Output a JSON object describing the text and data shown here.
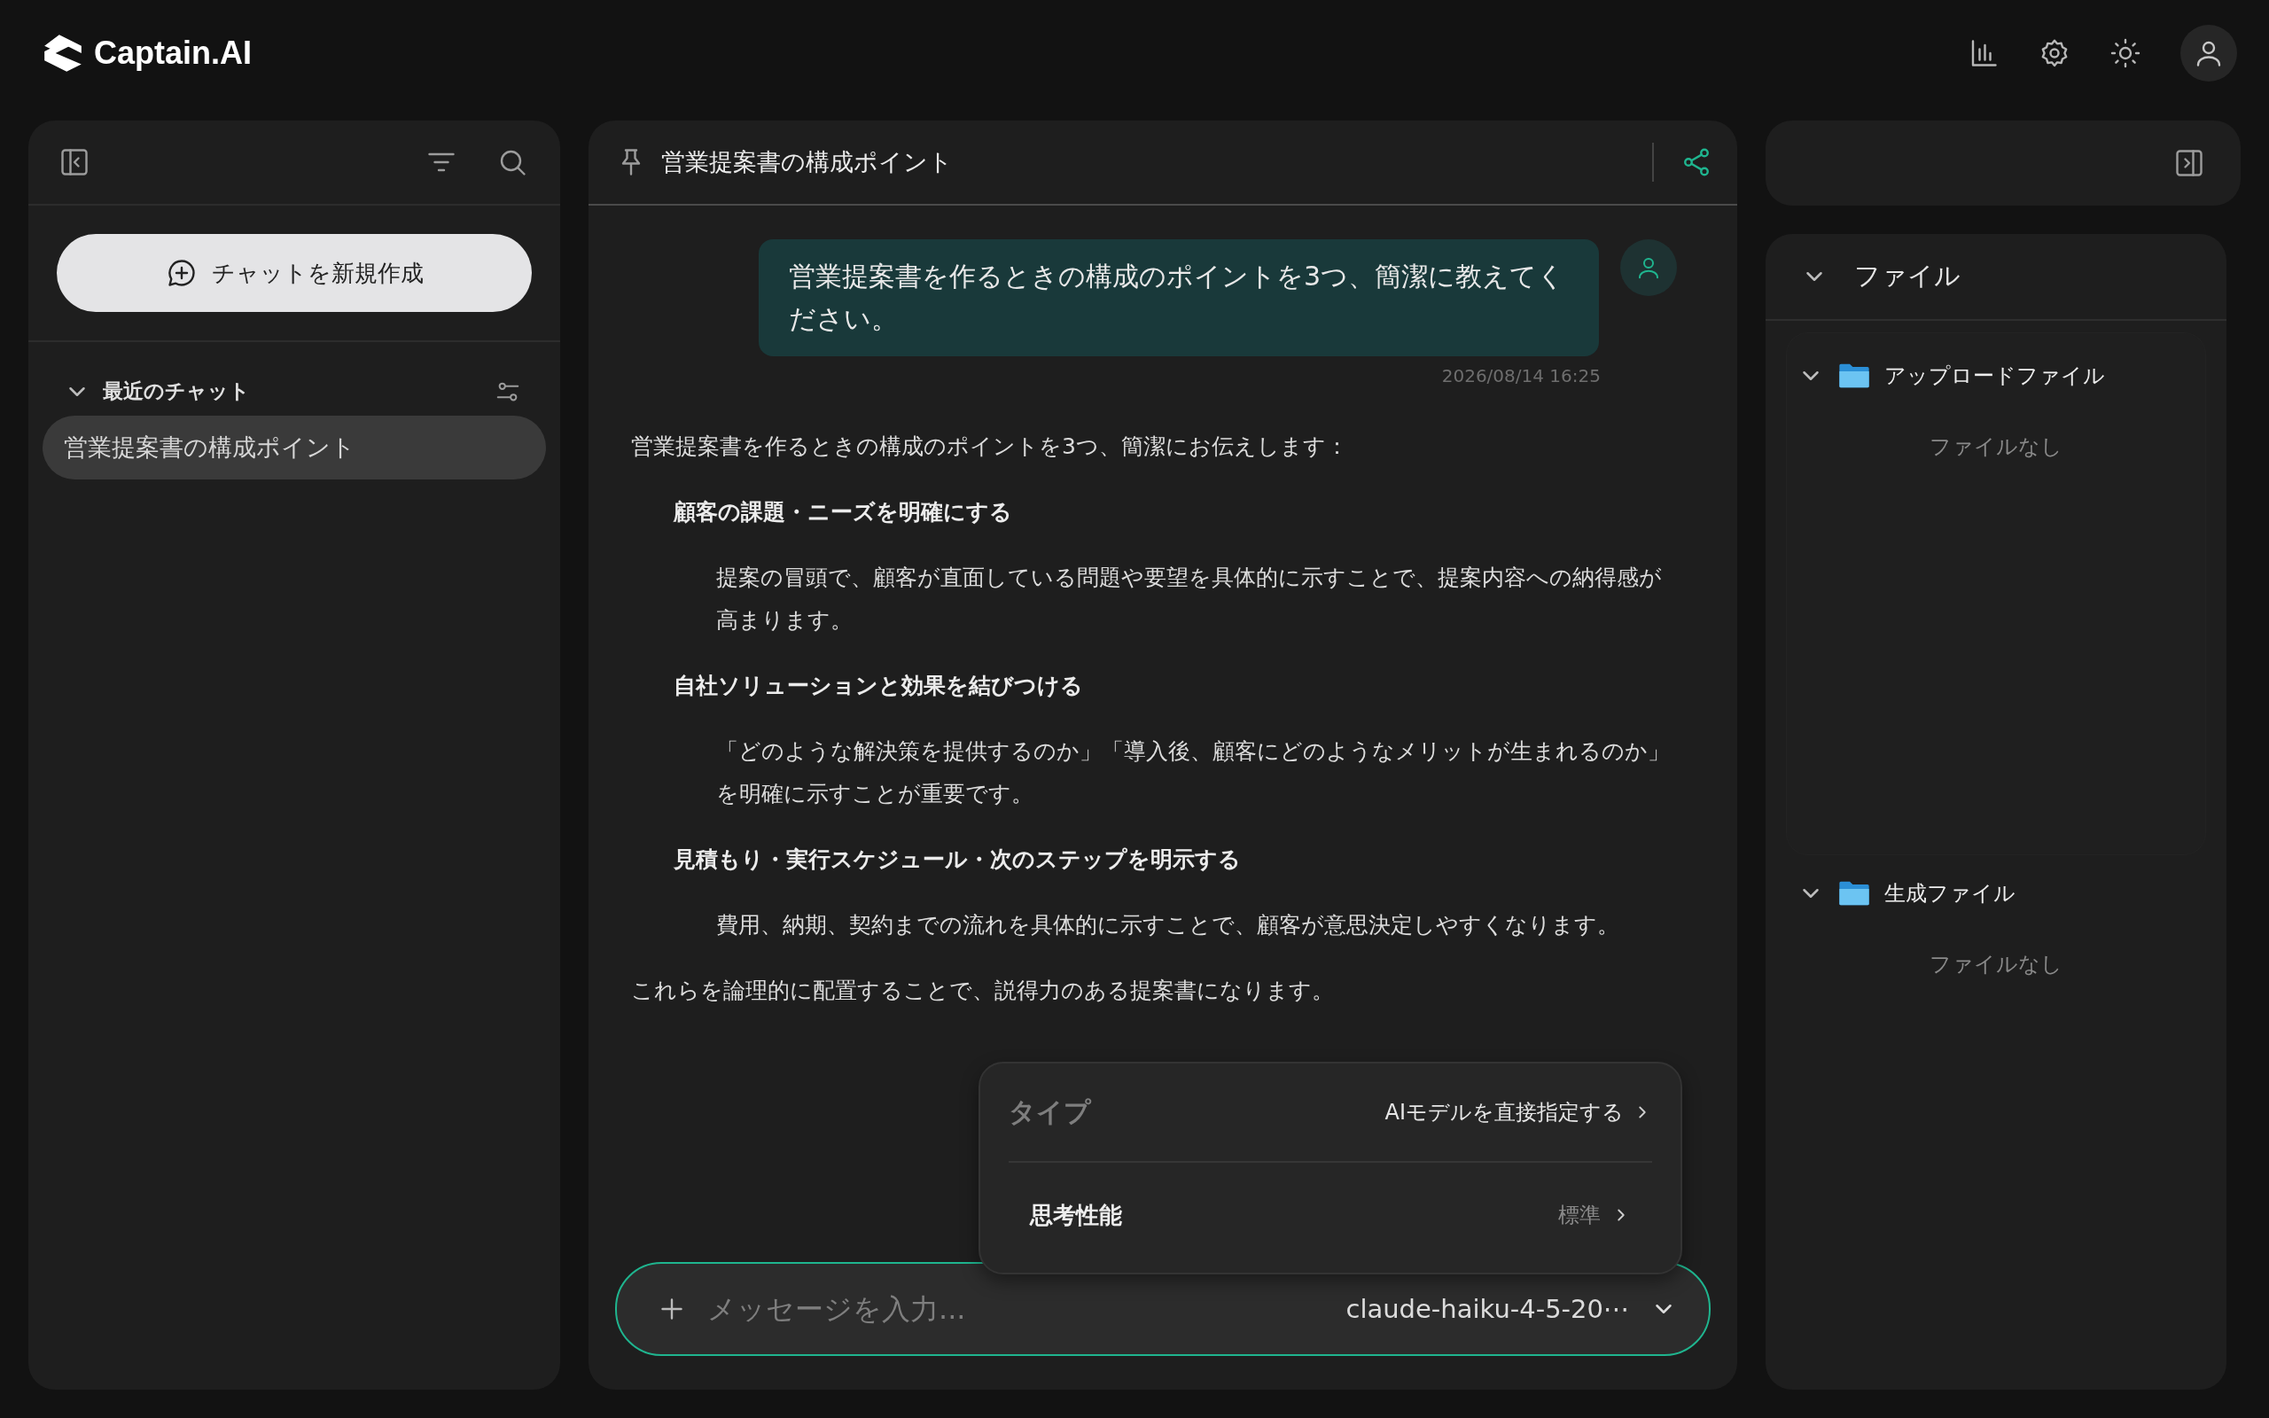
{
  "app": {
    "name": "Captain.AI"
  },
  "sidebar": {
    "new_chat_button": "チャットを新規作成",
    "recent_heading": "最近のチャット",
    "recent_expanded": true,
    "chats": [
      {
        "title": "営業提案書の構成ポイント",
        "selected": true
      }
    ]
  },
  "chat": {
    "title": "営業提案書の構成ポイント",
    "messages": [
      {
        "kind": "user",
        "text": "営業提案書を作るときの構成のポイントを3つ、簡潔に教えてください。",
        "timestamp": "2026/08/14 16:25"
      },
      {
        "kind": "assistant",
        "blocks": [
          {
            "kind": "paragraph",
            "text": "営業提案書を作るときの構成のポイントを3つ、簡潔にお伝えします："
          },
          {
            "kind": "heading",
            "text": "顧客の課題・ニーズを明確にする"
          },
          {
            "kind": "detail",
            "text": "提案の冒頭で、顧客が直面している問題や要望を具体的に示すことで、提案内容への納得感が高まります。"
          },
          {
            "kind": "heading",
            "text": "自社ソリューションと効果を結びつける"
          },
          {
            "kind": "detail",
            "text": "「どのような解決策を提供するのか」「導入後、顧客にどのようなメリットが生まれるのか」を明確に示すことが重要です。"
          },
          {
            "kind": "heading",
            "text": "見積もり・実行スケジュール・次のステップを明示する"
          },
          {
            "kind": "detail",
            "text": "費用、納期、契約までの流れを具体的に示すことで、顧客が意思決定しやすくなります。"
          },
          {
            "kind": "paragraph",
            "text": "これらを論理的に配置することで、説得力のある提案書になります。"
          }
        ]
      }
    ]
  },
  "model_menu": {
    "type_label": "タイプ",
    "direct_link": "AIモデルを直接指定する",
    "rows": [
      {
        "label": "思考性能",
        "value": "標準"
      }
    ]
  },
  "composer": {
    "placeholder": "メッセージを入力...",
    "model": "claude-haiku-4-5-20⋯"
  },
  "files_panel": {
    "title": "ファイル",
    "expanded": true,
    "folders": [
      {
        "name": "アップロードファイル",
        "expanded": true,
        "empty_text": "ファイルなし"
      },
      {
        "name": "生成ファイル",
        "expanded": true,
        "empty_text": "ファイルなし"
      }
    ]
  }
}
